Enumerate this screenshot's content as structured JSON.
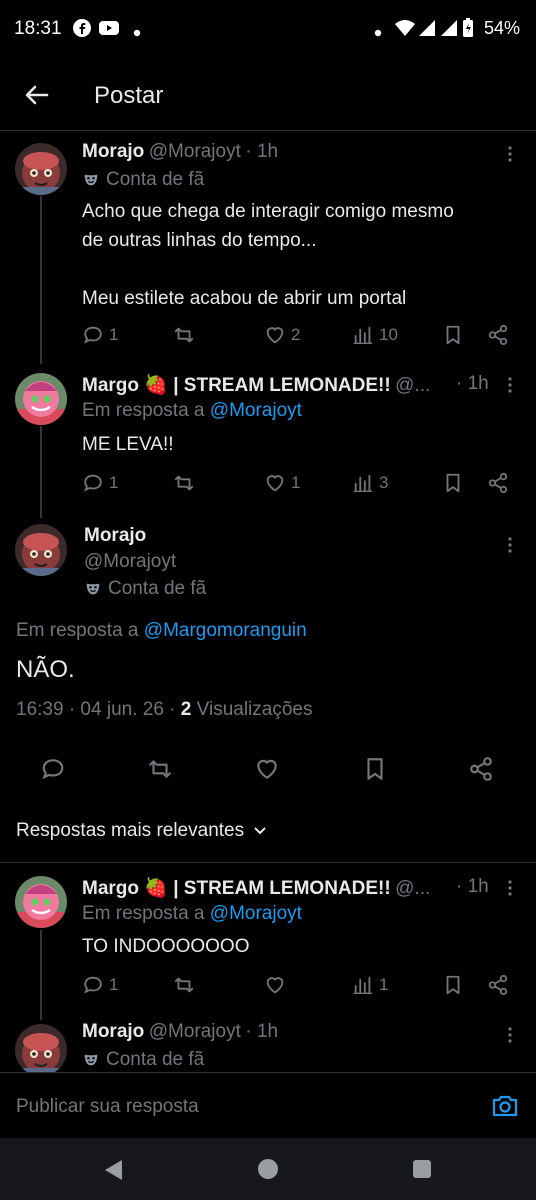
{
  "status_bar": {
    "time": "18:31",
    "battery": "54%"
  },
  "header": {
    "title": "Postar"
  },
  "tweet1": {
    "name": "Morajo",
    "handle": "@Morajoyt",
    "time": "· 1h",
    "badge": "Conta de fã",
    "text_line1": "Acho que chega de interagir comigo mesmo",
    "text_line2": "de outras linhas do tempo...",
    "text_line3": "Meu estilete acabou de abrir um portal",
    "replies": "1",
    "likes": "2",
    "views": "10"
  },
  "tweet2": {
    "name": "Margo 🍓 | STREAM LEMONADE!!",
    "handle": "@...",
    "time": "· 1h",
    "reply_prefix": "Em resposta a",
    "reply_to": "@Morajoyt",
    "text": "ME LEVA!!",
    "replies": "1",
    "likes": "1",
    "views": "3"
  },
  "main": {
    "name": "Morajo",
    "handle": "@Morajoyt",
    "badge": "Conta de fã",
    "reply_prefix": "Em resposta a",
    "reply_to": "@Margomoranguin",
    "text": "NÃO.",
    "timestamp": "16:39 · 04 jun. 26 ·",
    "views_count": "2",
    "views_label": "Visualizações"
  },
  "sort": {
    "label": "Respostas mais relevantes"
  },
  "reply1": {
    "name": "Margo 🍓 | STREAM LEMONADE!!",
    "handle": "@...",
    "time": "· 1h",
    "reply_prefix": "Em resposta a",
    "reply_to": "@Morajoyt",
    "text": "TO INDOOOOOOO",
    "replies": "1",
    "views": "1"
  },
  "reply2": {
    "name": "Morajo",
    "handle": "@Morajoyt",
    "time": "· 1h",
    "badge": "Conta de fã"
  },
  "composer": {
    "placeholder": "Publicar sua resposta"
  },
  "colors": {
    "accent": "#1d9bf0",
    "background": "#000000",
    "muted": "#71767b"
  }
}
